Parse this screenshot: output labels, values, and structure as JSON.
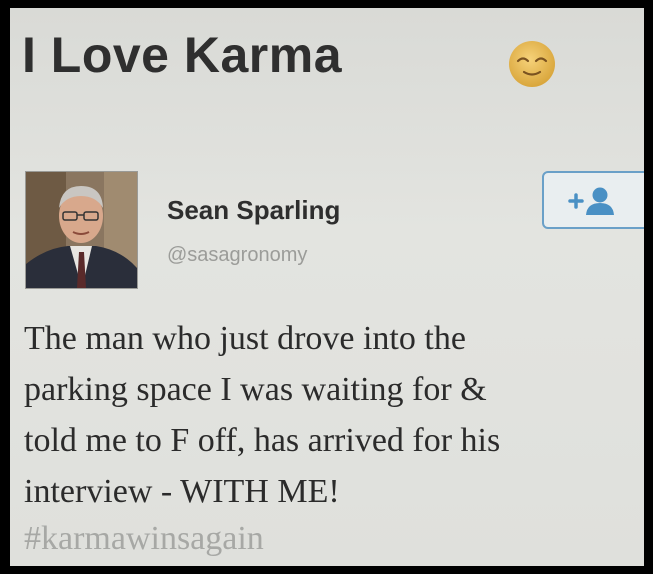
{
  "title": "I Love Karma",
  "emoji": "relieved-face",
  "tweet": {
    "author_name": "Sean Sparling",
    "author_handle": "@sasagronomy",
    "follow_icon": "add-user-icon",
    "lines": [
      "The man who just drove into the",
      "parking space I was waiting for &",
      "told me to F off, has arrived for his",
      "interview - WITH ME!"
    ],
    "hashtag": "#karmawinsagain"
  },
  "colors": {
    "follow_border": "#6aa0c8",
    "follow_icon": "#4a90c4",
    "hashtag": "#a7a8a5"
  }
}
